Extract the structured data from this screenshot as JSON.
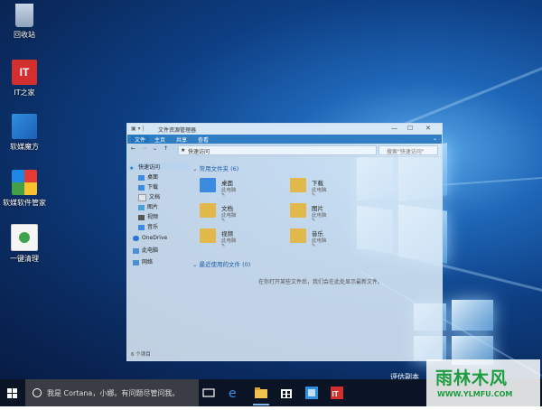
{
  "desktop": {
    "icons": [
      {
        "label": "回收站",
        "icon": "recycle-bin-icon"
      },
      {
        "label": "IT之家",
        "icon": "ithome-icon",
        "glyph": "IT"
      },
      {
        "label": "软媒魔方",
        "icon": "ruanmei-mofang-icon"
      },
      {
        "label": "软媒软件管家",
        "icon": "ruanmei-software-manager-icon"
      },
      {
        "label": "一键清理",
        "icon": "one-click-cleanup-icon"
      }
    ],
    "evaluation_text": "评估副本"
  },
  "explorer": {
    "title": "文件资源管理器",
    "ribbon_tabs": [
      "文件",
      "主页",
      "共享",
      "查看"
    ],
    "address_path": "快速访问",
    "search_placeholder": "搜索\"快速访问\"",
    "nav_items": [
      {
        "label": "快速访问",
        "icon": "star-icon"
      },
      {
        "label": "桌面",
        "icon": "desktop-folder-icon"
      },
      {
        "label": "下载",
        "icon": "download-icon"
      },
      {
        "label": "文档",
        "icon": "documents-icon"
      },
      {
        "label": "图片",
        "icon": "pictures-icon"
      },
      {
        "label": "视频",
        "icon": "videos-icon"
      },
      {
        "label": "音乐",
        "icon": "music-icon"
      },
      {
        "label": "OneDrive",
        "icon": "cloud-icon"
      },
      {
        "label": "此电脑",
        "icon": "computer-icon"
      },
      {
        "label": "网络",
        "icon": "network-icon"
      }
    ],
    "frequent_header": "常用文件夹 (6)",
    "folders": [
      {
        "name": "桌面",
        "sub": "此电脑"
      },
      {
        "name": "下载",
        "sub": "此电脑"
      },
      {
        "name": "文档",
        "sub": "此电脑"
      },
      {
        "name": "图片",
        "sub": "此电脑"
      },
      {
        "name": "视频",
        "sub": "此电脑"
      },
      {
        "name": "音乐",
        "sub": "此电脑"
      }
    ],
    "recent_header": "最近使用的文件 (0)",
    "empty_message": "在你打开某些文件后，我们会在此处显示最新文件。",
    "status": "6 个项目"
  },
  "taskbar": {
    "cortana_text": "我是 Cortana，小娜。有问题尽管问我。",
    "apps": [
      "task-view-icon",
      "edge-icon",
      "file-explorer-icon",
      "store-icon",
      "mofang-icon",
      "ithome-icon"
    ]
  },
  "watermark": {
    "brand": "雨林木风",
    "url": "WWW.YLMFU.COM"
  },
  "colors": {
    "desktop_accent": "#1f67b8",
    "ribbon": "#1f73bf",
    "taskbar": "#0b1424",
    "watermark_green": "#1c9c3c"
  }
}
